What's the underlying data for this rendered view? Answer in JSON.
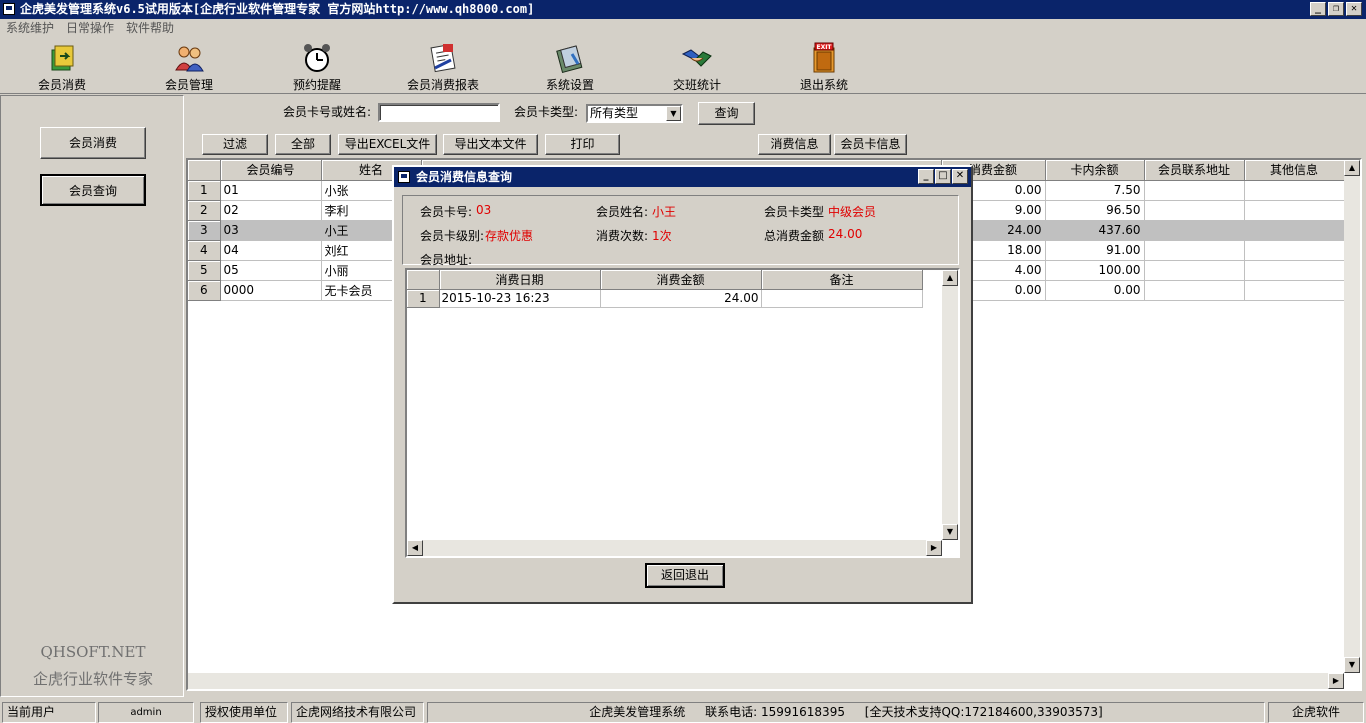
{
  "window": {
    "title": "企虎美发管理系统v6.5试用版本[企虎行业软件管理专家 官方网站http://www.qh8000.com]"
  },
  "menu": [
    "系统维护",
    "日常操作",
    "软件帮助"
  ],
  "toolbar": [
    {
      "label": "会员消费",
      "icon": "money-transfer-icon"
    },
    {
      "label": "会员管理",
      "icon": "users-icon"
    },
    {
      "label": "预约提醒",
      "icon": "alarm-clock-icon"
    },
    {
      "label": "会员消费报表",
      "icon": "report-icon"
    },
    {
      "label": "系统设置",
      "icon": "settings-book-icon"
    },
    {
      "label": "交班统计",
      "icon": "handshake-icon"
    },
    {
      "label": "退出系统",
      "icon": "exit-door-icon"
    }
  ],
  "exit_sign": "EXIT",
  "sidebar": {
    "buttons": [
      "会员消费",
      "会员查询"
    ],
    "brand_line1": "QHSOFT.NET",
    "brand_line2": "企虎行业软件专家"
  },
  "search": {
    "card_label": "会员卡号或姓名:",
    "card_value": "",
    "type_label": "会员卡类型:",
    "type_value": "所有类型",
    "query_button": "查询"
  },
  "actions": {
    "filter": "过滤",
    "all": "全部",
    "export_excel": "导出EXCEL文件",
    "export_text": "导出文本文件",
    "print": "打印",
    "consume_info": "消费信息",
    "card_info": "会员卡信息"
  },
  "grid": {
    "columns": [
      "会员编号",
      "姓名",
      "消费金额",
      "卡内余额",
      "会员联系地址",
      "其他信息"
    ],
    "rows": [
      {
        "n": "1",
        "id": "01",
        "name": "小张",
        "spent": "0.00",
        "balance": "7.50",
        "addr": "",
        "other": ""
      },
      {
        "n": "2",
        "id": "02",
        "name": "李利",
        "spent": "9.00",
        "balance": "96.50",
        "addr": "",
        "other": ""
      },
      {
        "n": "3",
        "id": "03",
        "name": "小王",
        "spent": "24.00",
        "balance": "437.60",
        "addr": "",
        "other": ""
      },
      {
        "n": "4",
        "id": "04",
        "name": "刘红",
        "spent": "18.00",
        "balance": "91.00",
        "addr": "",
        "other": ""
      },
      {
        "n": "5",
        "id": "05",
        "name": "小丽",
        "spent": "4.00",
        "balance": "100.00",
        "addr": "",
        "other": ""
      },
      {
        "n": "6",
        "id": "0000",
        "name": "无卡会员",
        "spent": "0.00",
        "balance": "0.00",
        "addr": "",
        "other": ""
      }
    ]
  },
  "dialog": {
    "title": "会员消费信息查询",
    "card_no_label": "会员卡号:",
    "card_no": "03",
    "name_label": "会员姓名:",
    "name": "小王",
    "type_label": "会员卡类型",
    "type": "中级会员",
    "level_label": "会员卡级别:",
    "level": "存款优惠",
    "count_label": "消费次数:",
    "count": "1次",
    "total_label": "总消费金额",
    "total": "24.00",
    "address_label": "会员地址:",
    "address": "",
    "columns": [
      "消费日期",
      "消费金额",
      "备注"
    ],
    "rows": [
      {
        "n": "1",
        "date": "2015-10-23 16:23",
        "amount": "24.00",
        "note": ""
      }
    ],
    "back_button": "返回退出"
  },
  "statusbar": {
    "user_label": "当前用户",
    "user": "admin",
    "licensee_label": "授权使用单位",
    "licensee": "企虎网络技术有限公司",
    "system": "企虎美发管理系统",
    "phone": "联系电话: 15991618395",
    "support": "[全天技术支持QQ:172184600,33903573]",
    "company": "企虎软件"
  },
  "colors": {
    "titlebar": "#0a246a",
    "highlight_text": "#e00000",
    "selected_row": "#c0c0c0"
  }
}
